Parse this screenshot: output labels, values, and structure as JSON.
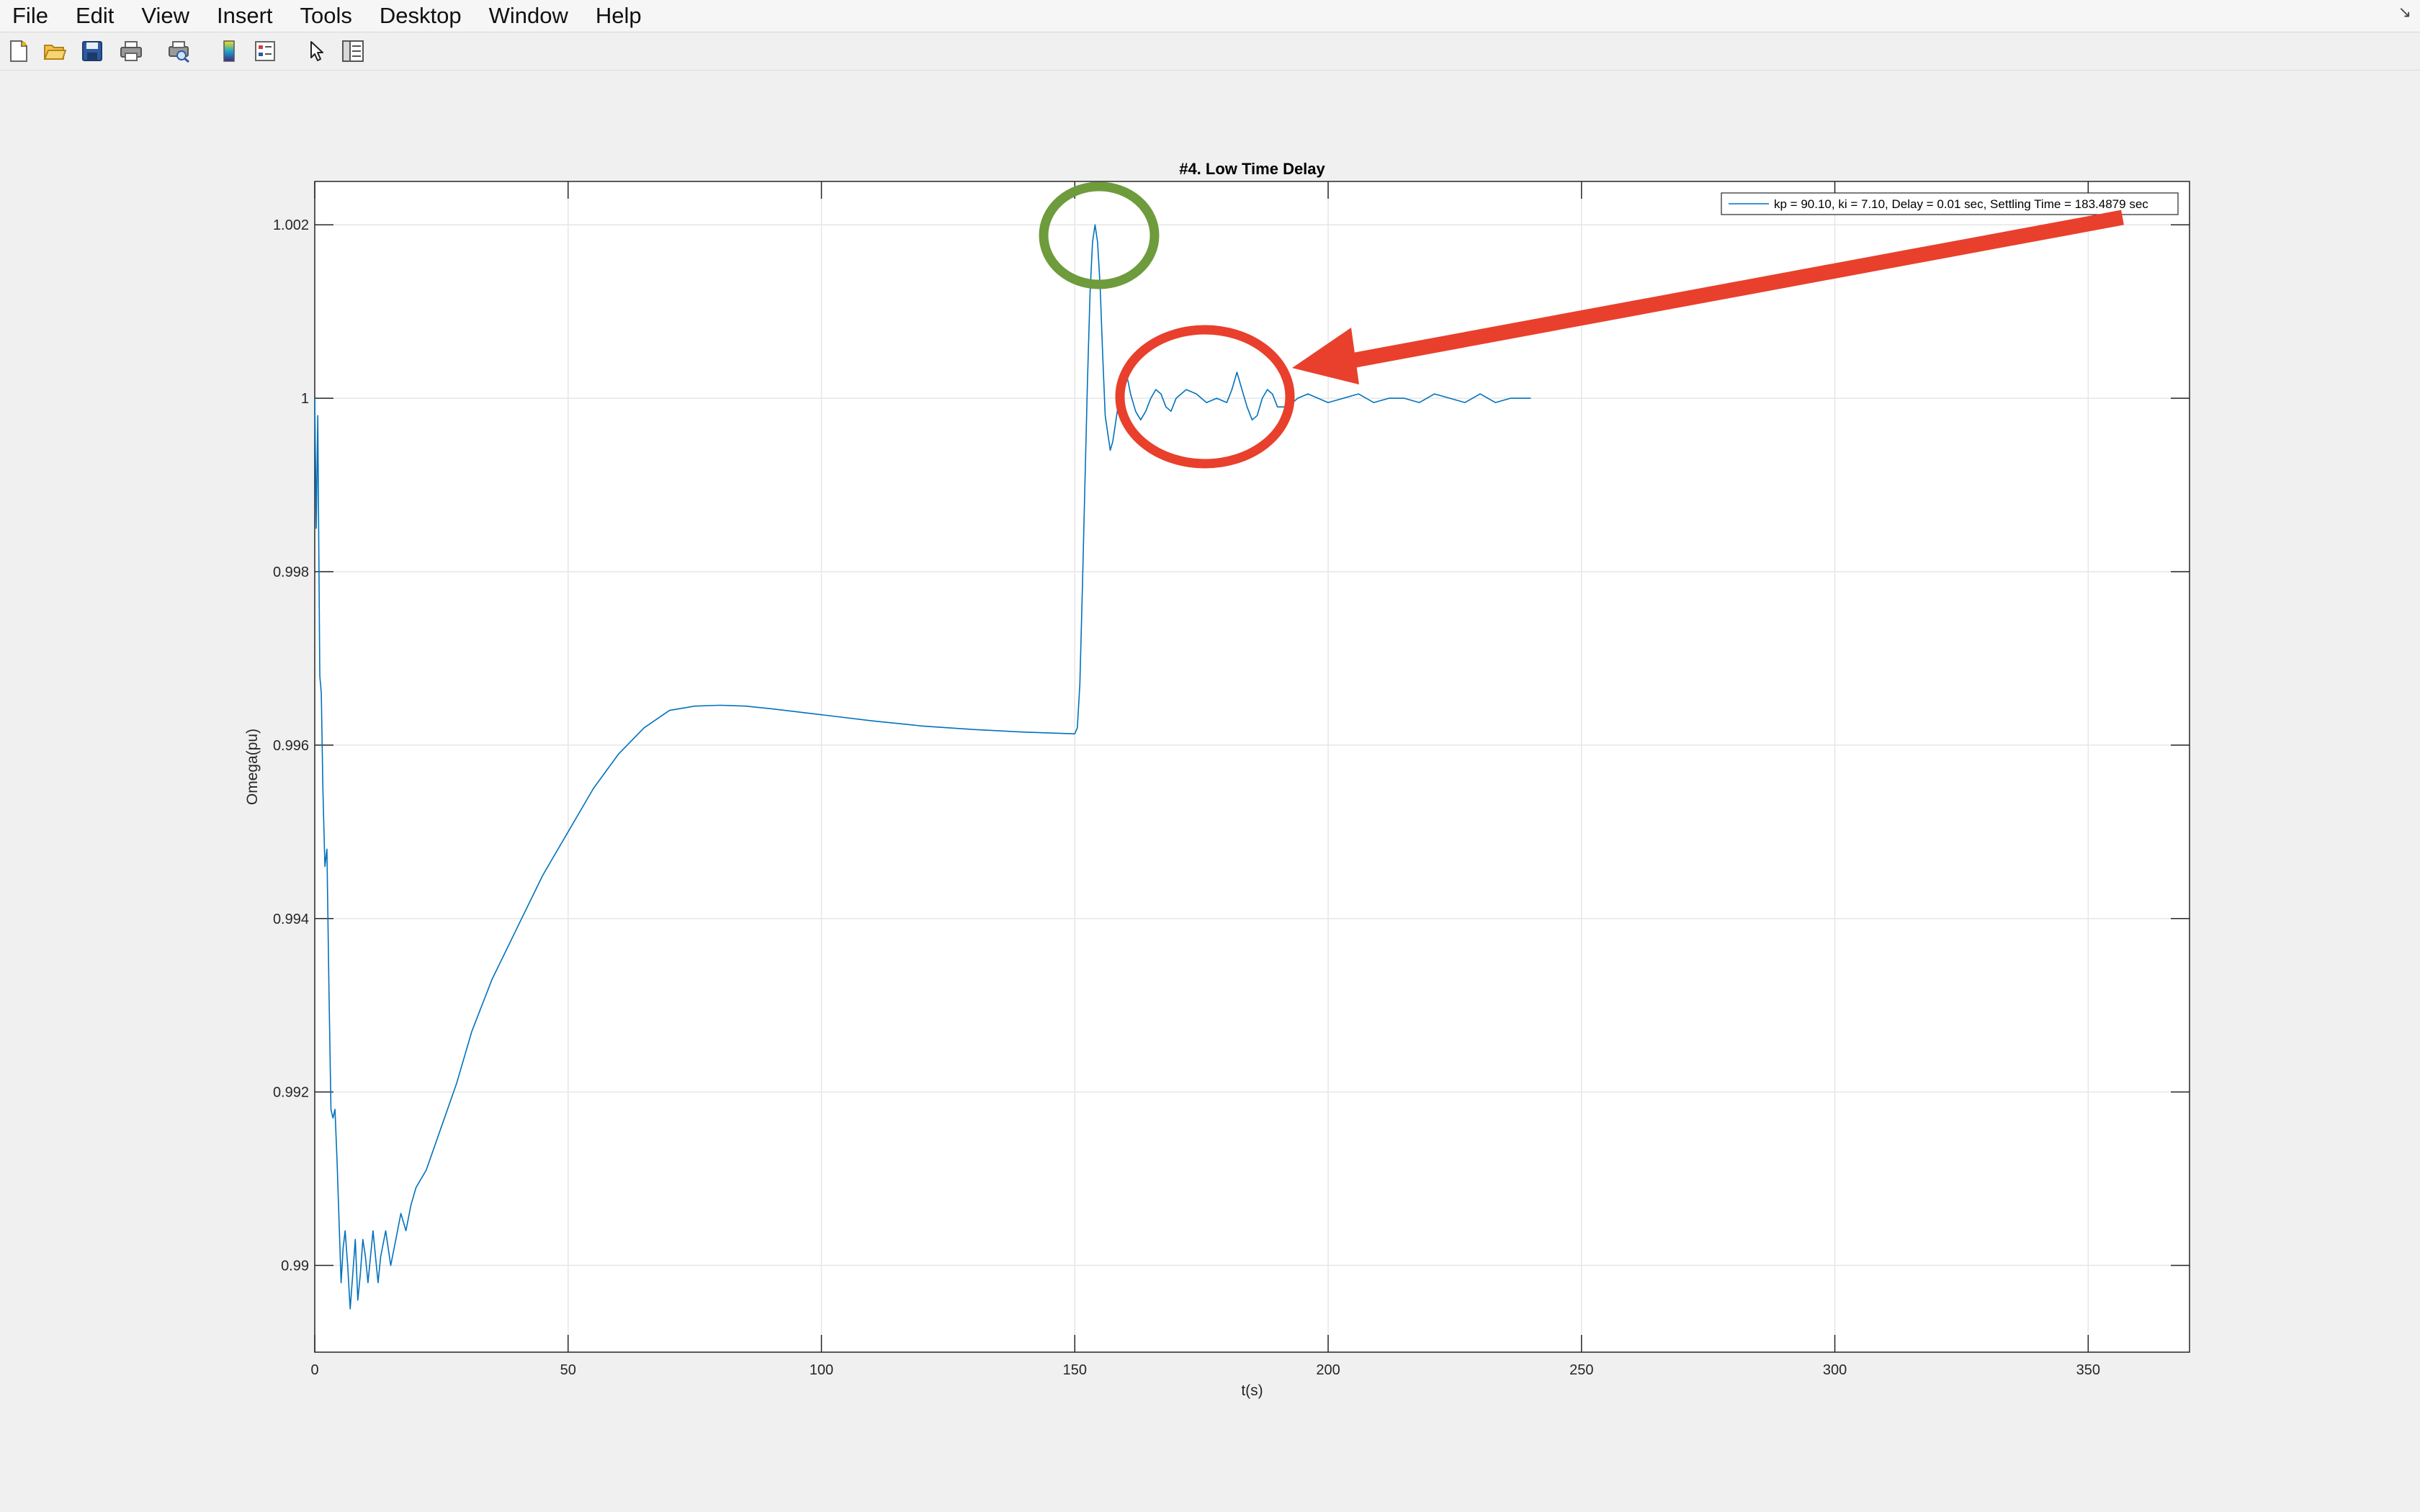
{
  "menubar": {
    "items": [
      "File",
      "Edit",
      "View",
      "Insert",
      "Tools",
      "Desktop",
      "Window",
      "Help"
    ]
  },
  "toolbar": {
    "icons": [
      "new-figure-icon",
      "open-file-icon",
      "save-icon",
      "print-icon",
      "print-preview-icon",
      "insert-colorbar-icon",
      "insert-legend-icon",
      "select-pointer-icon",
      "property-editor-icon"
    ]
  },
  "chart_data": {
    "type": "line",
    "title": "#4. Low Time Delay",
    "xlabel": "t(s)",
    "ylabel": "Omega(pu)",
    "xlim": [
      0,
      370
    ],
    "ylim": [
      0.989,
      1.0025
    ],
    "xticks": [
      0,
      50,
      100,
      150,
      200,
      250,
      300,
      350
    ],
    "xtick_labels": [
      "0",
      "50",
      "100",
      "150",
      "200",
      "250",
      "300",
      "350"
    ],
    "yticks": [
      0.99,
      0.992,
      0.994,
      0.996,
      0.998,
      1.0,
      1.002
    ],
    "ytick_labels": [
      "0.99",
      "0.992",
      "0.994",
      "0.996",
      "0.998",
      "1",
      "1.002"
    ],
    "grid": true,
    "legend_position": "top-right",
    "series": [
      {
        "name": "kp = 90.10, ki = 7.10, Delay = 0.01 sec, Settling Time = 183.4879 sec",
        "color": "#0072bd",
        "x": [
          0,
          0.3,
          0.6,
          1.0,
          1.3,
          1.6,
          2.0,
          2.4,
          2.8,
          3.2,
          3.6,
          4.0,
          4.4,
          4.8,
          5.2,
          5.6,
          6.0,
          6.5,
          7.0,
          7.5,
          8.0,
          8.5,
          9.0,
          9.5,
          10.0,
          10.5,
          11.0,
          11.5,
          12.0,
          12.5,
          13.0,
          14.0,
          15.0,
          16.0,
          17.0,
          18.0,
          19.0,
          20.0,
          22.0,
          25.0,
          28.0,
          31.0,
          35.0,
          40.0,
          45.0,
          50.0,
          55.0,
          60.0,
          65.0,
          70.0,
          75.0,
          80.0,
          85.0,
          90.0,
          100.0,
          110.0,
          120.0,
          130.0,
          140.0,
          150.0,
          150.5,
          151.0,
          151.5,
          152.0,
          152.5,
          153.0,
          153.5,
          154.0,
          154.5,
          155.0,
          155.5,
          156.0,
          156.5,
          157.0,
          157.5,
          158.0,
          158.5,
          159.0,
          159.5,
          160.0,
          160.5,
          161.0,
          162.0,
          163.0,
          164.0,
          165.0,
          166.0,
          167.0,
          168.0,
          169.0,
          170.0,
          172.0,
          174.0,
          176.0,
          178.0,
          180.0,
          181.0,
          182.0,
          183.0,
          184.0,
          185.0,
          186.0,
          187.0,
          188.0,
          189.0,
          190.0,
          192.0,
          194.0,
          196.0,
          198.0,
          200.0,
          203.0,
          206.0,
          209.0,
          212.0,
          215.0,
          218.0,
          221.0,
          224.0,
          227.0,
          230.0,
          233.0,
          236.0,
          240.0
        ],
        "y": [
          1.0,
          0.9985,
          0.9998,
          0.9968,
          0.9966,
          0.9955,
          0.9946,
          0.9948,
          0.9932,
          0.9918,
          0.9917,
          0.9918,
          0.9912,
          0.9905,
          0.9898,
          0.9902,
          0.9904,
          0.99,
          0.9895,
          0.9899,
          0.9903,
          0.9896,
          0.9899,
          0.9903,
          0.9901,
          0.9898,
          0.9901,
          0.9904,
          0.9901,
          0.9898,
          0.9901,
          0.9904,
          0.99,
          0.9903,
          0.9906,
          0.9904,
          0.9907,
          0.9909,
          0.9911,
          0.9916,
          0.9921,
          0.9927,
          0.9933,
          0.9939,
          0.9945,
          0.995,
          0.9955,
          0.9959,
          0.9962,
          0.9964,
          0.99645,
          0.99646,
          0.99645,
          0.99642,
          0.99635,
          0.99628,
          0.99622,
          0.99618,
          0.99615,
          0.99613,
          0.9962,
          0.9967,
          0.9978,
          0.999,
          1.0002,
          1.0012,
          1.0018,
          1.002,
          1.0018,
          1.0013,
          1.0005,
          0.9998,
          0.9996,
          0.9994,
          0.9995,
          0.9997,
          0.9999,
          1.0002,
          1.0003,
          1.0003,
          1.0002,
          1.00005,
          0.99985,
          0.99975,
          0.99985,
          1.0,
          1.0001,
          1.00005,
          0.9999,
          0.99985,
          1.0,
          1.0001,
          1.00005,
          0.99995,
          1.0,
          0.99995,
          1.0001,
          1.0003,
          1.0001,
          0.9999,
          0.99975,
          0.9998,
          1.0,
          1.0001,
          1.00005,
          0.9999,
          0.9999,
          1.0,
          1.00005,
          1.0,
          0.99995,
          1.0,
          1.00005,
          0.99995,
          1.0,
          1.0,
          0.99995,
          1.00005,
          1.0,
          0.99995,
          1.00005,
          0.99995,
          1.0,
          1.0
        ]
      }
    ],
    "annotations": [
      {
        "type": "ellipse",
        "color": "#6e9b3c",
        "label": "peak-highlight"
      },
      {
        "type": "ellipse",
        "color": "#e8402c",
        "label": "oscillation-highlight"
      },
      {
        "type": "arrow",
        "color": "#e8402c",
        "label": "pointer-arrow"
      }
    ]
  }
}
